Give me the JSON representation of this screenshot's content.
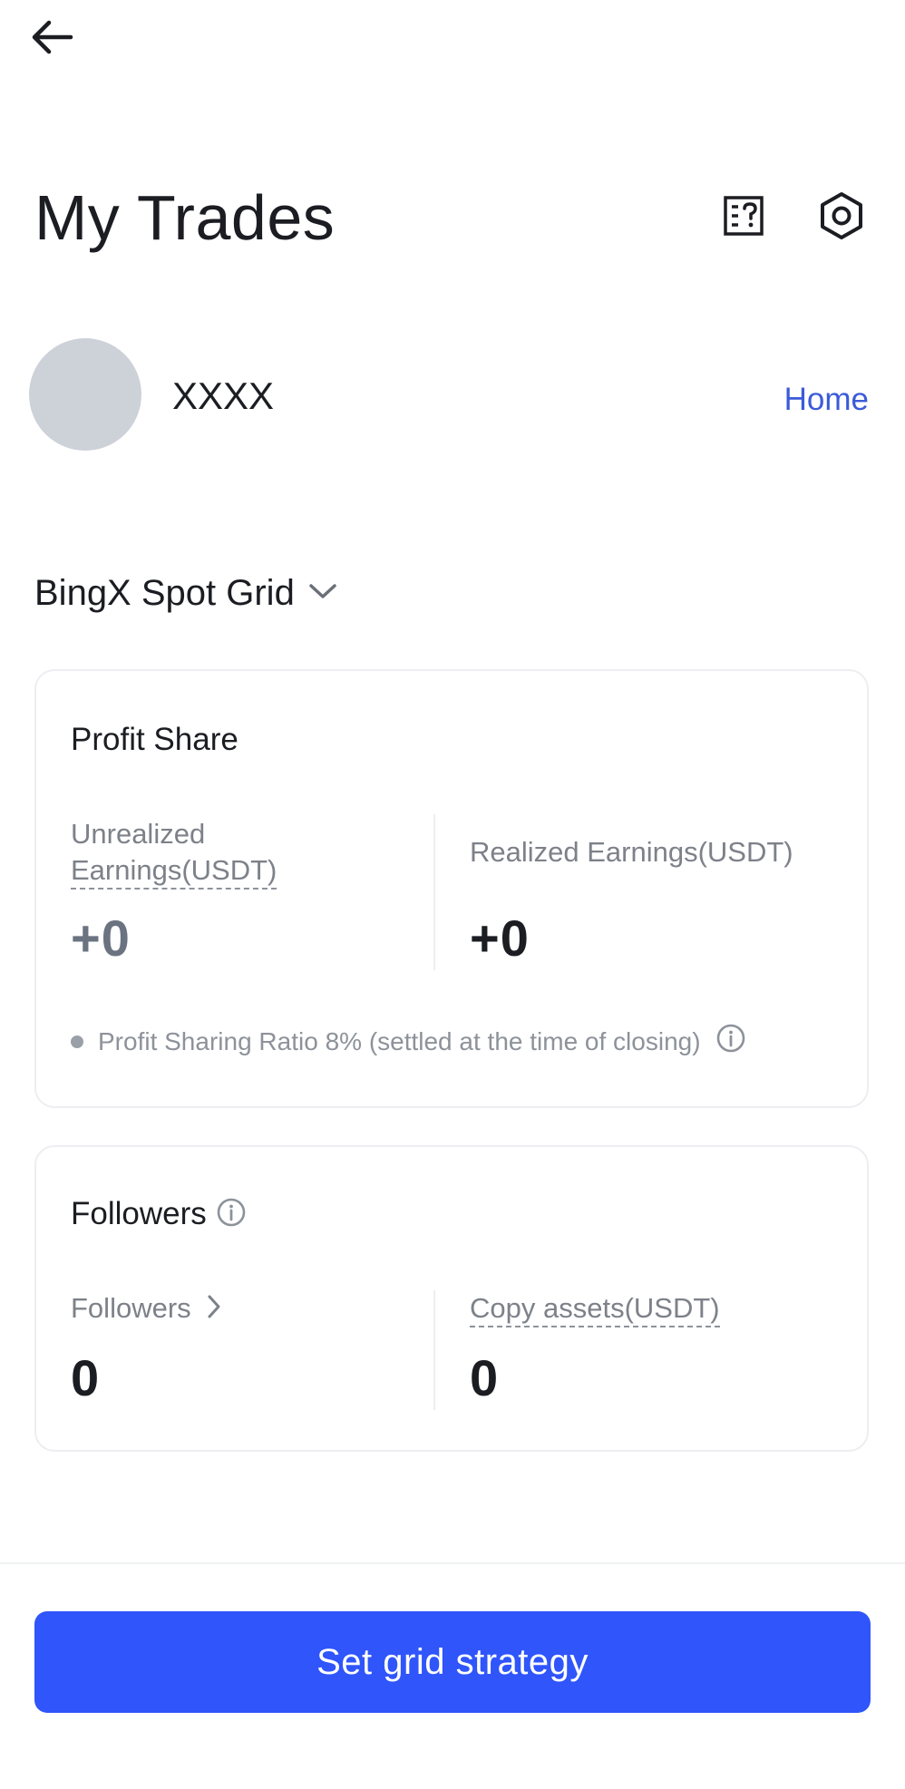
{
  "header": {
    "title": "My Trades",
    "back_icon": "arrow-left-icon",
    "help_icon": "help-document-icon",
    "settings_icon": "hexagon-settings-icon"
  },
  "profile": {
    "username": "XXXX",
    "home_link": "Home"
  },
  "product_selector": {
    "selected": "BingX Spot Grid"
  },
  "profit_share": {
    "title": "Profit Share",
    "unrealized_label_line1": "Unrealized",
    "unrealized_label_line2": "Earnings(USDT)",
    "unrealized_value": "+0",
    "realized_label": "Realized Earnings(USDT)",
    "realized_value": "+0",
    "note": "Profit Sharing Ratio 8% (settled at the time of closing)"
  },
  "followers_card": {
    "title": "Followers",
    "followers_label": "Followers",
    "followers_value": "0",
    "copy_assets_label": "Copy assets(USDT)",
    "copy_assets_value": "0"
  },
  "cta": {
    "label": "Set grid strategy"
  },
  "colors": {
    "primary": "#2f55fb",
    "link": "#3b5bd8",
    "text": "#1b1d22",
    "muted": "#7d8189"
  }
}
